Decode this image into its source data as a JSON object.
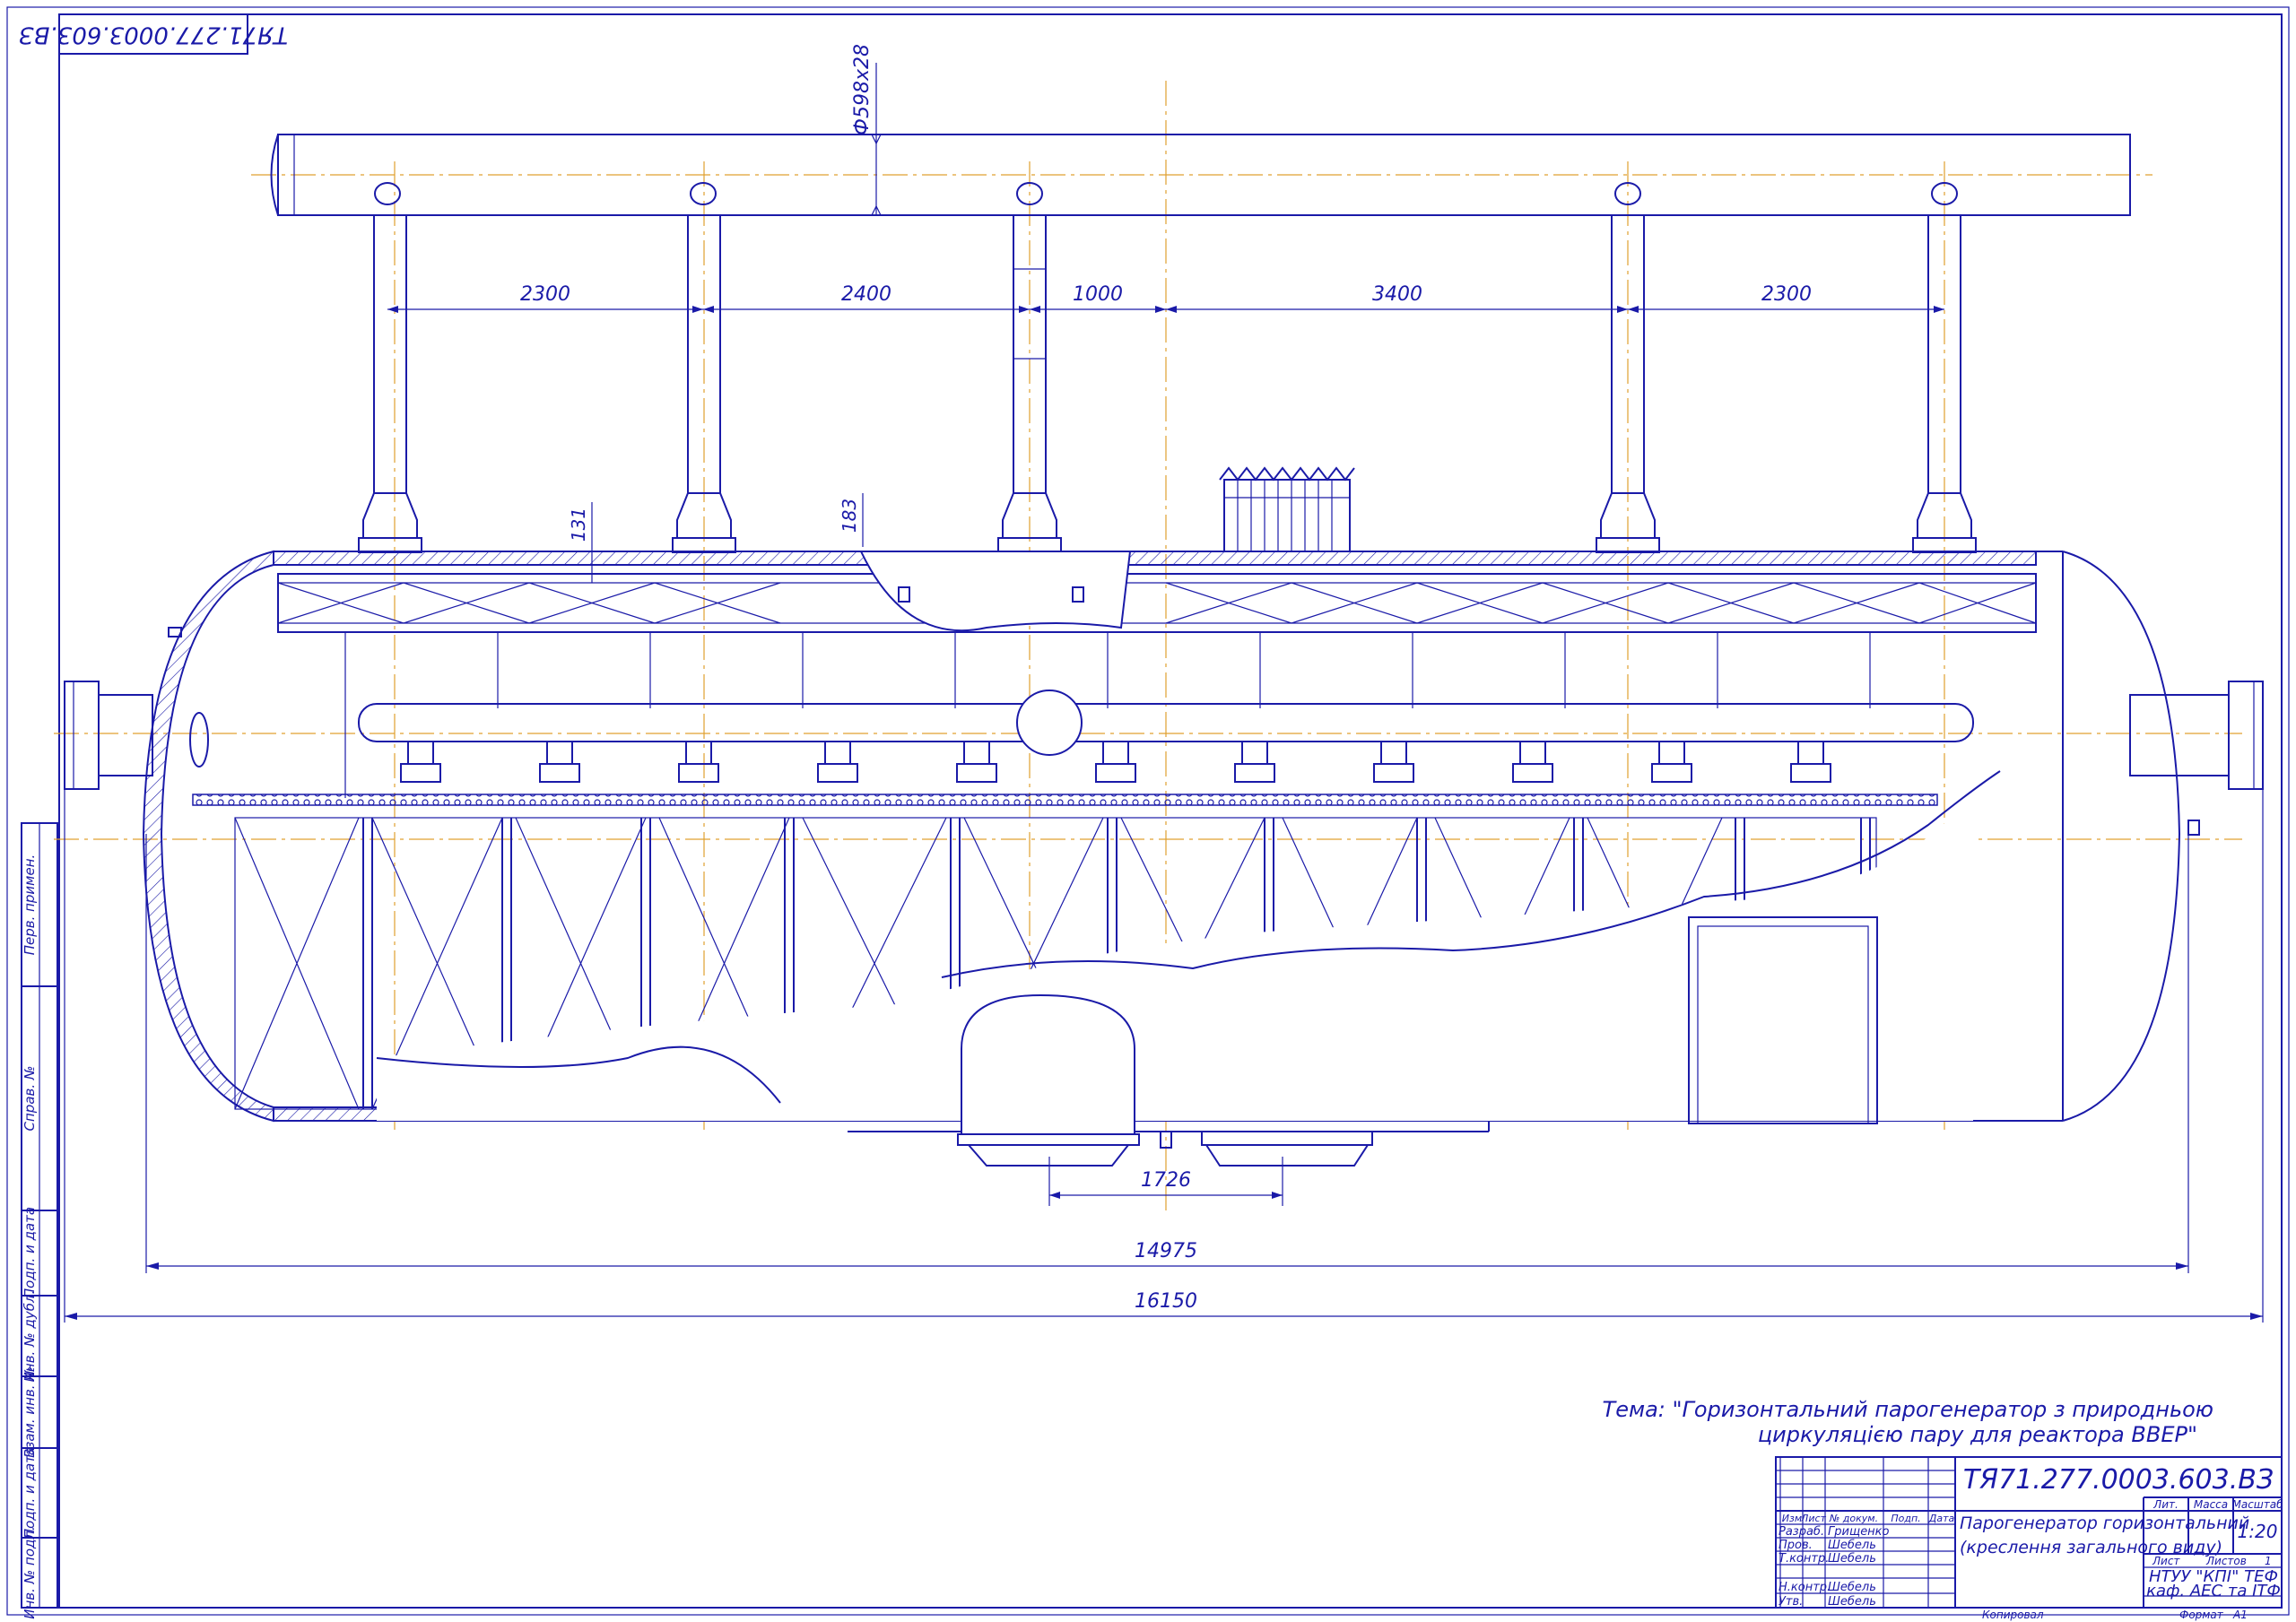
{
  "corner_code": "ТЯ71.277.0003.603.ВЗ",
  "dimensions": {
    "pipe_diameter": "Ф598х28",
    "spacings": [
      "2300",
      "2400",
      "1000",
      "3400",
      "2300"
    ],
    "wall_a": "131",
    "wall_b": "183",
    "nozzle_gap": "1726",
    "body_length": "14975",
    "total_length": "16150"
  },
  "side_stamp": [
    "Перв. примен.",
    "Справ. №",
    "Подп. и дата",
    "Инв. № дубл.",
    "Взам. инв. №",
    "Подп. и дата",
    "Инв. № подл."
  ],
  "theme_line1": "Тема: \"Горизонтальний парогенератор з природньою",
  "theme_line2": "циркуляцією пару для реактора ВВЕР\"",
  "title_block": {
    "designation": "ТЯ71.277.0003.603.ВЗ",
    "name_line1": "Парогенератор горизонтальний",
    "name_line2": "(креслення загального виду)",
    "head_cols": [
      "Изм",
      "Лист",
      "№ докум.",
      "Подп.",
      "Дата"
    ],
    "roles": [
      "Разраб.",
      "Пров.",
      "Т.контр.",
      "Н.контр.",
      "Утв."
    ],
    "people": [
      "Грищенко",
      "Шебель",
      "Шебель",
      "Шебель",
      "Шебель"
    ],
    "lit": "Лит.",
    "mass": "Масса",
    "scale_label": "Масштаб",
    "scale": "1:20",
    "sheet": "Лист",
    "sheets": "Листов",
    "sheets_n": "1",
    "org_line1": "НТУУ \"КПІ\" ТЕФ",
    "org_line2": "каф. АЕС та ІТФ",
    "copied": "Копировал",
    "format": "Формат",
    "format_val": "А1"
  }
}
